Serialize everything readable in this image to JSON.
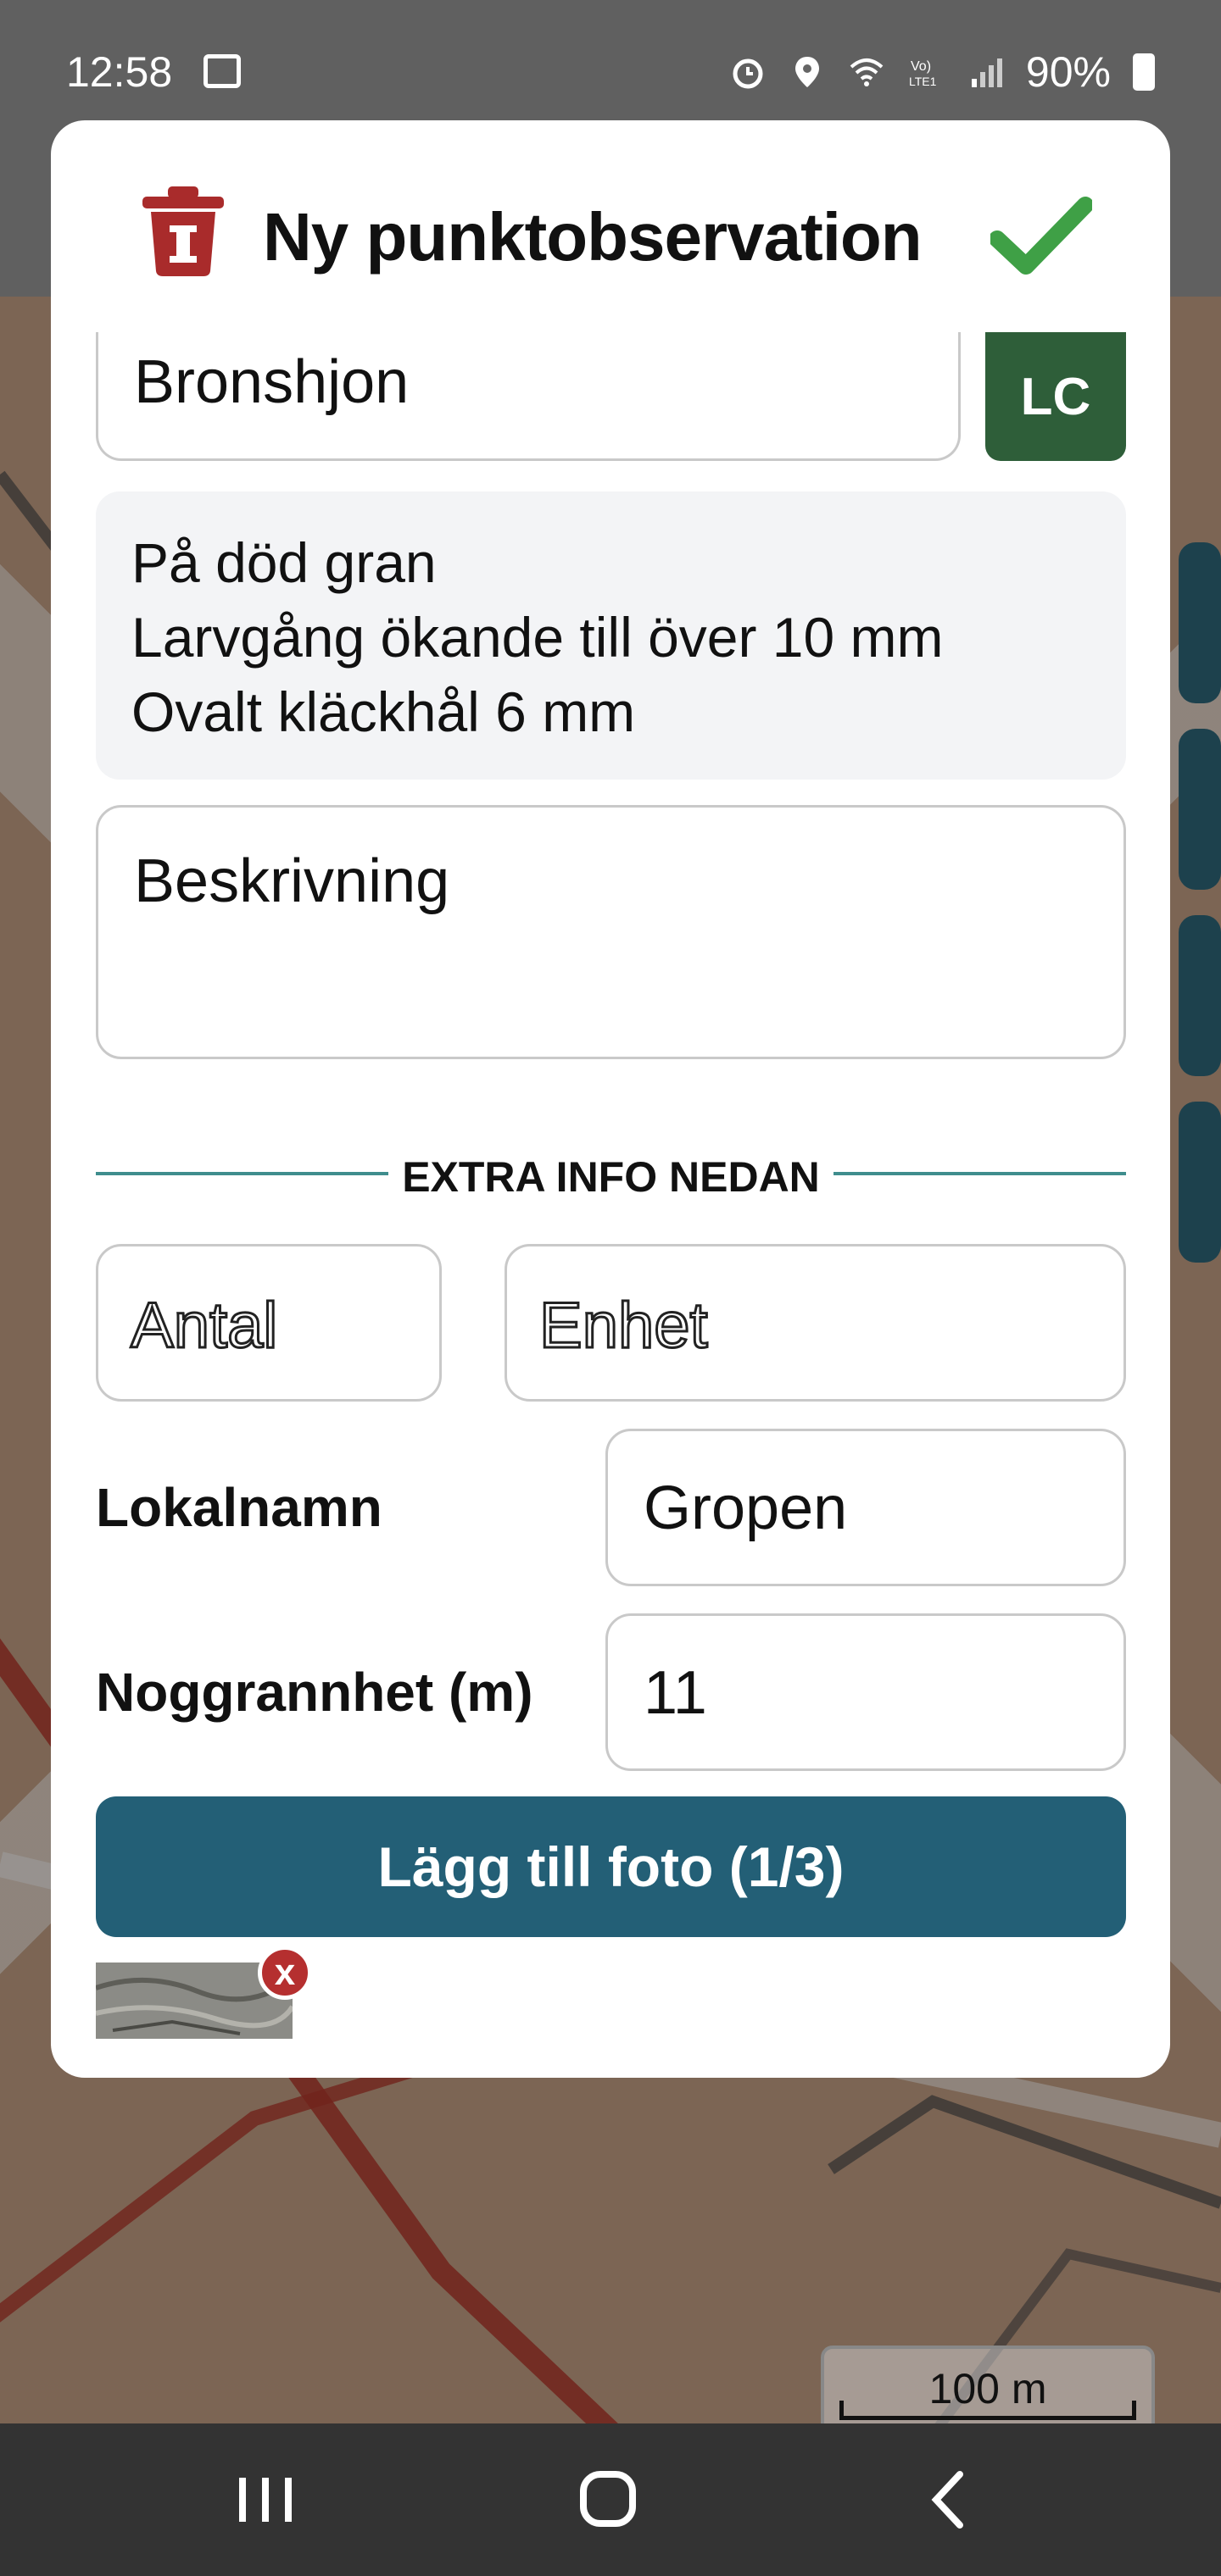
{
  "status_bar": {
    "time": "12:58",
    "battery": "90%",
    "icons": [
      "photo-icon",
      "alarm-icon",
      "location-icon",
      "wifi-icon",
      "volte-icon",
      "signal-icon",
      "battery-icon"
    ]
  },
  "dialog": {
    "title": "Ny punktobservation",
    "delete_icon": "trash-icon",
    "confirm_icon": "check-icon",
    "species_value": "Bronshjon",
    "redlist_badge": "LC",
    "info_lines": [
      "På död gran",
      "Larvgång ökande till över 10 mm",
      "Ovalt kläckhål 6 mm"
    ],
    "description_placeholder": "Beskrivning",
    "section_label": "EXTRA INFO NEDAN",
    "antal_placeholder": "Antal",
    "enhet_placeholder": "Enhet",
    "lokalnamn_label": "Lokalnamn",
    "lokalnamn_value": "Gropen",
    "noggrannhet_label": "Noggrannhet (m)",
    "noggrannhet_value": "11",
    "photo_button_label": "Lägg till foto (1/3)",
    "remove_photo_label": "x"
  },
  "map": {
    "scale_label": "100 m"
  },
  "colors": {
    "primary_button": "#235f76",
    "badge_lc": "#2e5e39",
    "confirm": "#3fa046",
    "delete": "#a92b2b",
    "divider": "#3f8d8d"
  }
}
